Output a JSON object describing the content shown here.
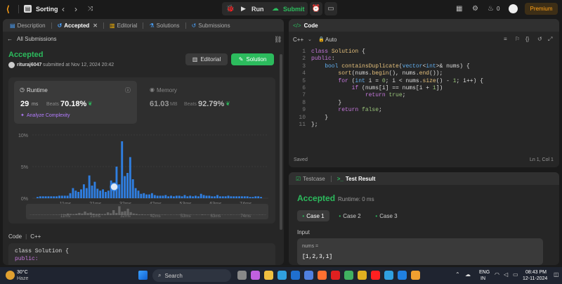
{
  "nav": {
    "problem_list": "Sorting",
    "run": "Run",
    "submit": "Submit",
    "streak": "0",
    "premium": "Premium"
  },
  "left_tabs": [
    {
      "label": "Description"
    },
    {
      "label": "Accepted"
    },
    {
      "label": "Editorial"
    },
    {
      "label": "Solutions"
    },
    {
      "label": "Submissions"
    }
  ],
  "back_label": "All Submissions",
  "result": {
    "status": "Accepted",
    "user": "rituraj6047",
    "submitted": "submitted at Nov 12, 2024 20:42",
    "editorial_btn": "Editorial",
    "solution_btn": "Solution"
  },
  "runtime": {
    "label": "Runtime",
    "value": "29",
    "unit": "ms",
    "beats_label": "Beats",
    "beats": "70.18%",
    "analyze": "Analyze Complexity"
  },
  "memory": {
    "label": "Memory",
    "value": "61.03",
    "unit": "MB",
    "beats_label": "Beats",
    "beats": "92.79%"
  },
  "chart_data": {
    "type": "bar",
    "ylabels": [
      "10%",
      "5%",
      "0%"
    ],
    "xlabels": [
      "11ms",
      "21ms",
      "32ms",
      "42ms",
      "53ms",
      "63ms",
      "74ms"
    ],
    "values": [
      0.2,
      0.3,
      0.3,
      0.3,
      0.3,
      0.3,
      0.3,
      0.3,
      0.4,
      0.4,
      0.4,
      0.4,
      0.8,
      1.6,
      1.2,
      1.0,
      1.4,
      2.2,
      1.6,
      3.6,
      2.0,
      2.6,
      1.5,
      1.2,
      1.4,
      1.0,
      1.2,
      2.8,
      1.8,
      5.0,
      2.2,
      9.0,
      3.5,
      4.0,
      6.5,
      3.0,
      1.6,
      1.2,
      0.7,
      0.8,
      0.6,
      0.6,
      0.8,
      0.5,
      0.4,
      0.4,
      0.4,
      0.5,
      0.3,
      0.4,
      0.3,
      0.4,
      0.4,
      0.3,
      0.5,
      0.3,
      0.4,
      0.3,
      0.4,
      0.3,
      0.7,
      0.5,
      0.4,
      0.4,
      0.3,
      0.3,
      0.5,
      0.3,
      0.3,
      0.3,
      0.4,
      0.3,
      0.3,
      0.3,
      0.3,
      0.3,
      0.3,
      0.3,
      0.2,
      0.2,
      0.3,
      0.3,
      0.2
    ],
    "highlight_index": 28,
    "ylim": [
      0,
      10
    ]
  },
  "code_section": {
    "label": "Code",
    "lang": "C++",
    "line1": "class Solution {",
    "line2": "public:"
  },
  "editor": {
    "title": "Code",
    "lang": "C++",
    "auto": "Auto",
    "status": "Saved",
    "cursor": "Ln 1, Col 1",
    "lines": [
      "class Solution {",
      "public:",
      "    bool containsDuplicate(vector<int>& nums) {",
      "        sort(nums.begin(), nums.end());",
      "        for (int i = 0; i < nums.size() - 1; i++) {",
      "            if (nums[i] == nums[i + 1])",
      "                return true;",
      "        }",
      "        return false;",
      "    }",
      "};"
    ]
  },
  "console": {
    "testcase_tab": "Testcase",
    "result_tab": "Test Result",
    "status": "Accepted",
    "runtime": "Runtime: 0 ms",
    "cases": [
      "Case 1",
      "Case 2",
      "Case 3"
    ],
    "input_label": "Input",
    "var": "nums =",
    "value": "[1,2,3,1]"
  },
  "taskbar": {
    "temp": "30°C",
    "weather": "Haze",
    "search": "Search",
    "lang1": "ENG",
    "lang2": "IN",
    "time": "08:43 PM",
    "date": "12-11-2024"
  }
}
